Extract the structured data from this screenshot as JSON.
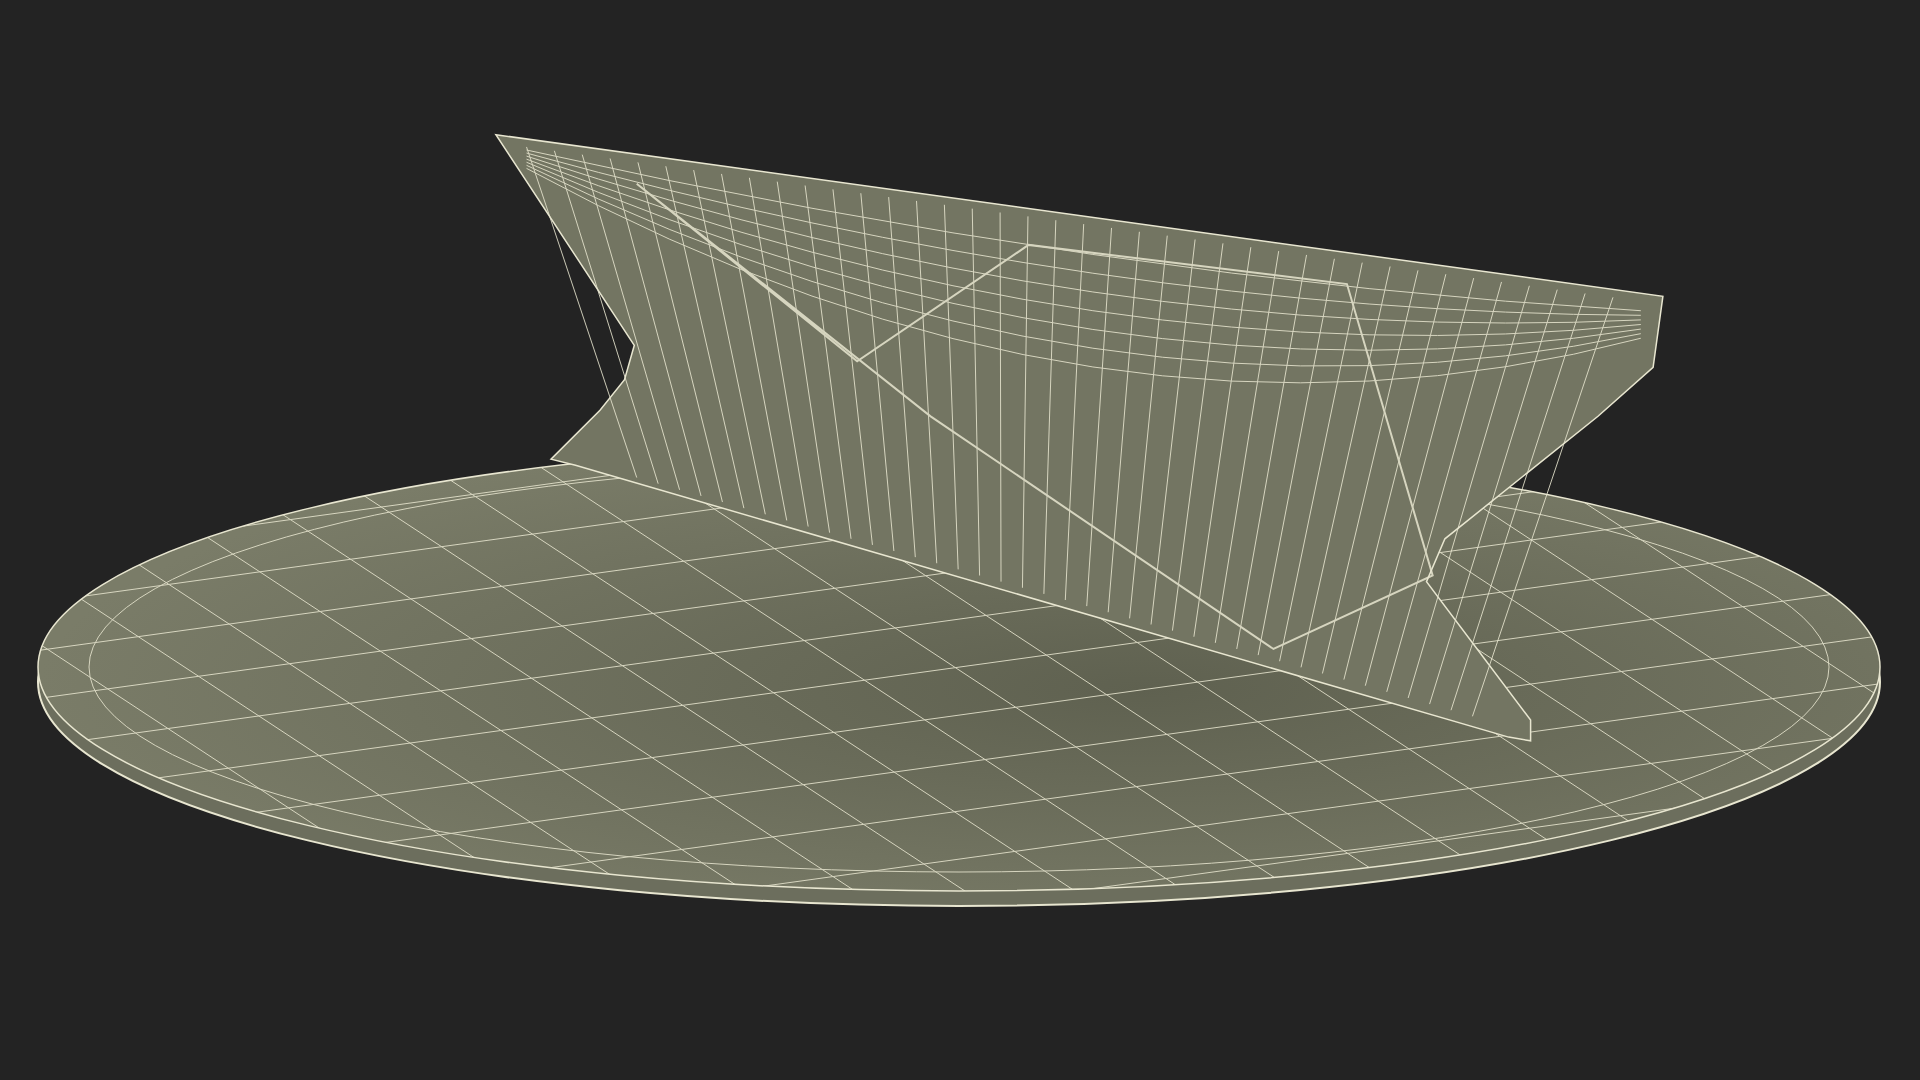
{
  "viewport": {
    "kind": "wireframe"
  }
}
